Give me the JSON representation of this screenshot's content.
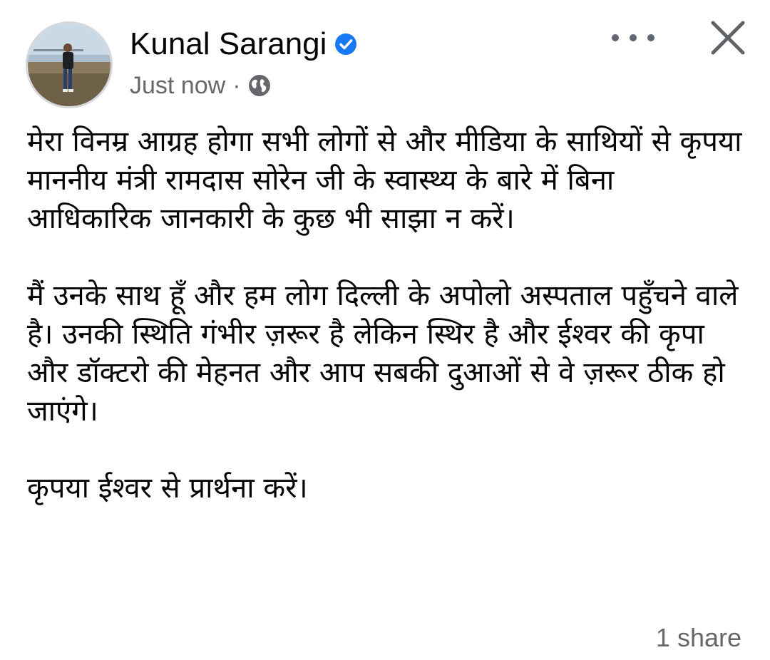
{
  "post": {
    "author": "Kunal Sarangi",
    "timestamp": "Just now",
    "separator": "·",
    "audience_icon": "globe-icon",
    "verified_icon": "verified-badge-icon",
    "more_icon": "more-options-icon",
    "close_icon": "close-icon",
    "paragraphs": [
      "मेरा विनम्र आग्रह होगा सभी लोगों से और मीडिया के साथियों से कृपया माननीय मंत्री रामदास सोरेन जी के स्वास्थ्य के बारे में बिना आधिकारिक जानकारी के कुछ भी साझा न करें।",
      "मैं उनके साथ हूँ और हम लोग दिल्ली के अपोलो अस्पताल पहुँचने वाले है। उनकी स्थिति गंभीर ज़रूर है लेकिन स्थिर है और ईश्वर की कृपा और डॉक्टरो की मेहनत और आप सबकी दुआओं से वे ज़रूर ठीक हो जाएंगे।",
      "कृपया ईश्वर से प्रार्थना करें।"
    ],
    "shares": "1 share"
  },
  "colors": {
    "verified_blue": "#1877f2",
    "meta_gray": "#65676b",
    "text": "#050505",
    "background": "#ffffff"
  }
}
